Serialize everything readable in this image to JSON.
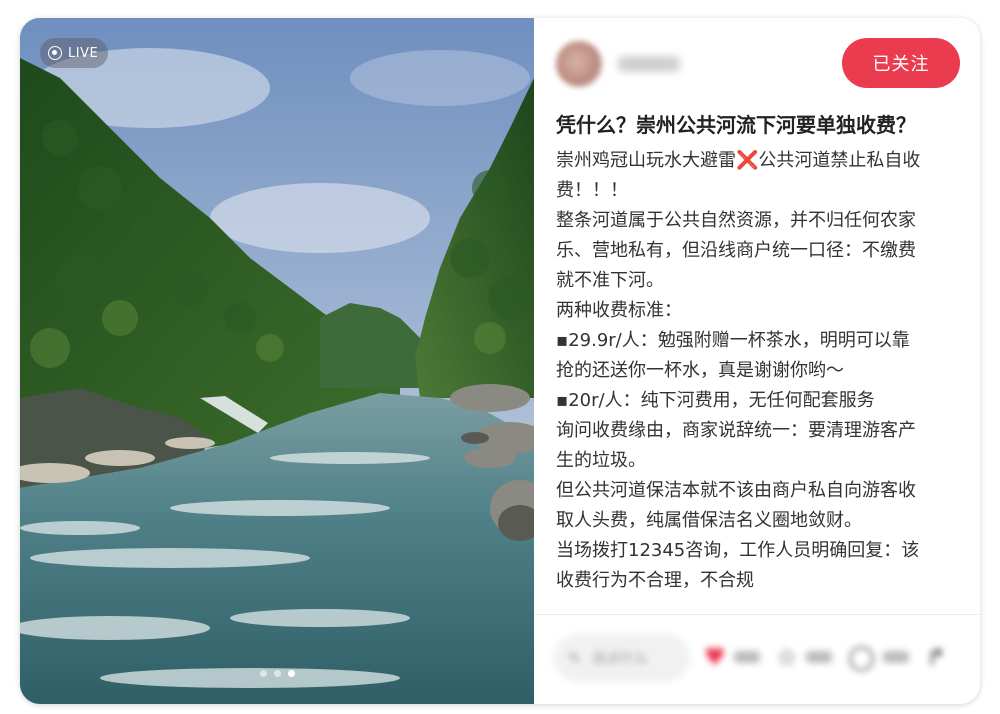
{
  "media": {
    "live_label": "LIVE",
    "carousel": {
      "count": 3,
      "active_index": 2
    }
  },
  "author": {
    "name": "",
    "follow_label": "已关注"
  },
  "post": {
    "title": "凭什么？崇州公共河流下河要单独收费？",
    "lines": [
      "崇州鸡冠山玩水大避雷❌公共河道禁止私自收",
      "费！！！",
      "",
      "整条河道属于公共自然资源，并不归任何农家",
      "乐、营地私有，但沿线商户统一口径：不缴费",
      "就不准下河。",
      "两种收费标准：",
      "▪︎29.9r/人：勉强附赠一杯茶水，明明可以靠",
      "抢的还送你一杯水，真是谢谢你哟～",
      "▪︎20r/人：纯下河费用，无任何配套服务",
      "询问收费缘由，商家说辞统一：要清理游客产",
      "生的垃圾。",
      "但公共河道保洁本就不该由商户私自向游客收",
      "取人头费，纯属借保洁名义圈地敛财。",
      "当场拨打12345咨询，工作人员明确回复：该",
      "收费行为不合理，不合规"
    ]
  },
  "bottom_bar": {
    "comment_placeholder": "说点什么",
    "icons": [
      "pen-icon",
      "heart-icon",
      "star-icon",
      "comment-icon",
      "share-icon"
    ]
  },
  "colors": {
    "accent": "#ea3b4f",
    "heart": "#e8324a"
  }
}
